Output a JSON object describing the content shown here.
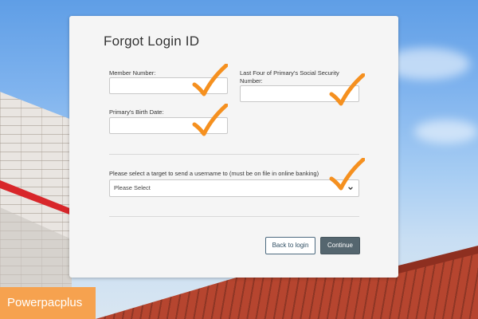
{
  "form": {
    "title": "Forgot Login ID",
    "member_number_label": "Member Number:",
    "ssn_label_line1": "Last Four of Primary's Social Security",
    "ssn_label_line2": "Number:",
    "birth_date_label": "Primary's Birth Date:",
    "target_label": "Please select a target to send a username to (must be on file in online banking)",
    "target_select_value": "Please Select",
    "back_button": "Back to login",
    "continue_button": "Continue"
  },
  "watermark": "Powerpacplus",
  "colors": {
    "checkmark": "#f5901f",
    "continue_button": "#55666f",
    "watermark_bg": "#f6a24f"
  },
  "icons": {
    "checkmark": "checkmark-icon",
    "dropdown": "chevron-down-icon"
  }
}
